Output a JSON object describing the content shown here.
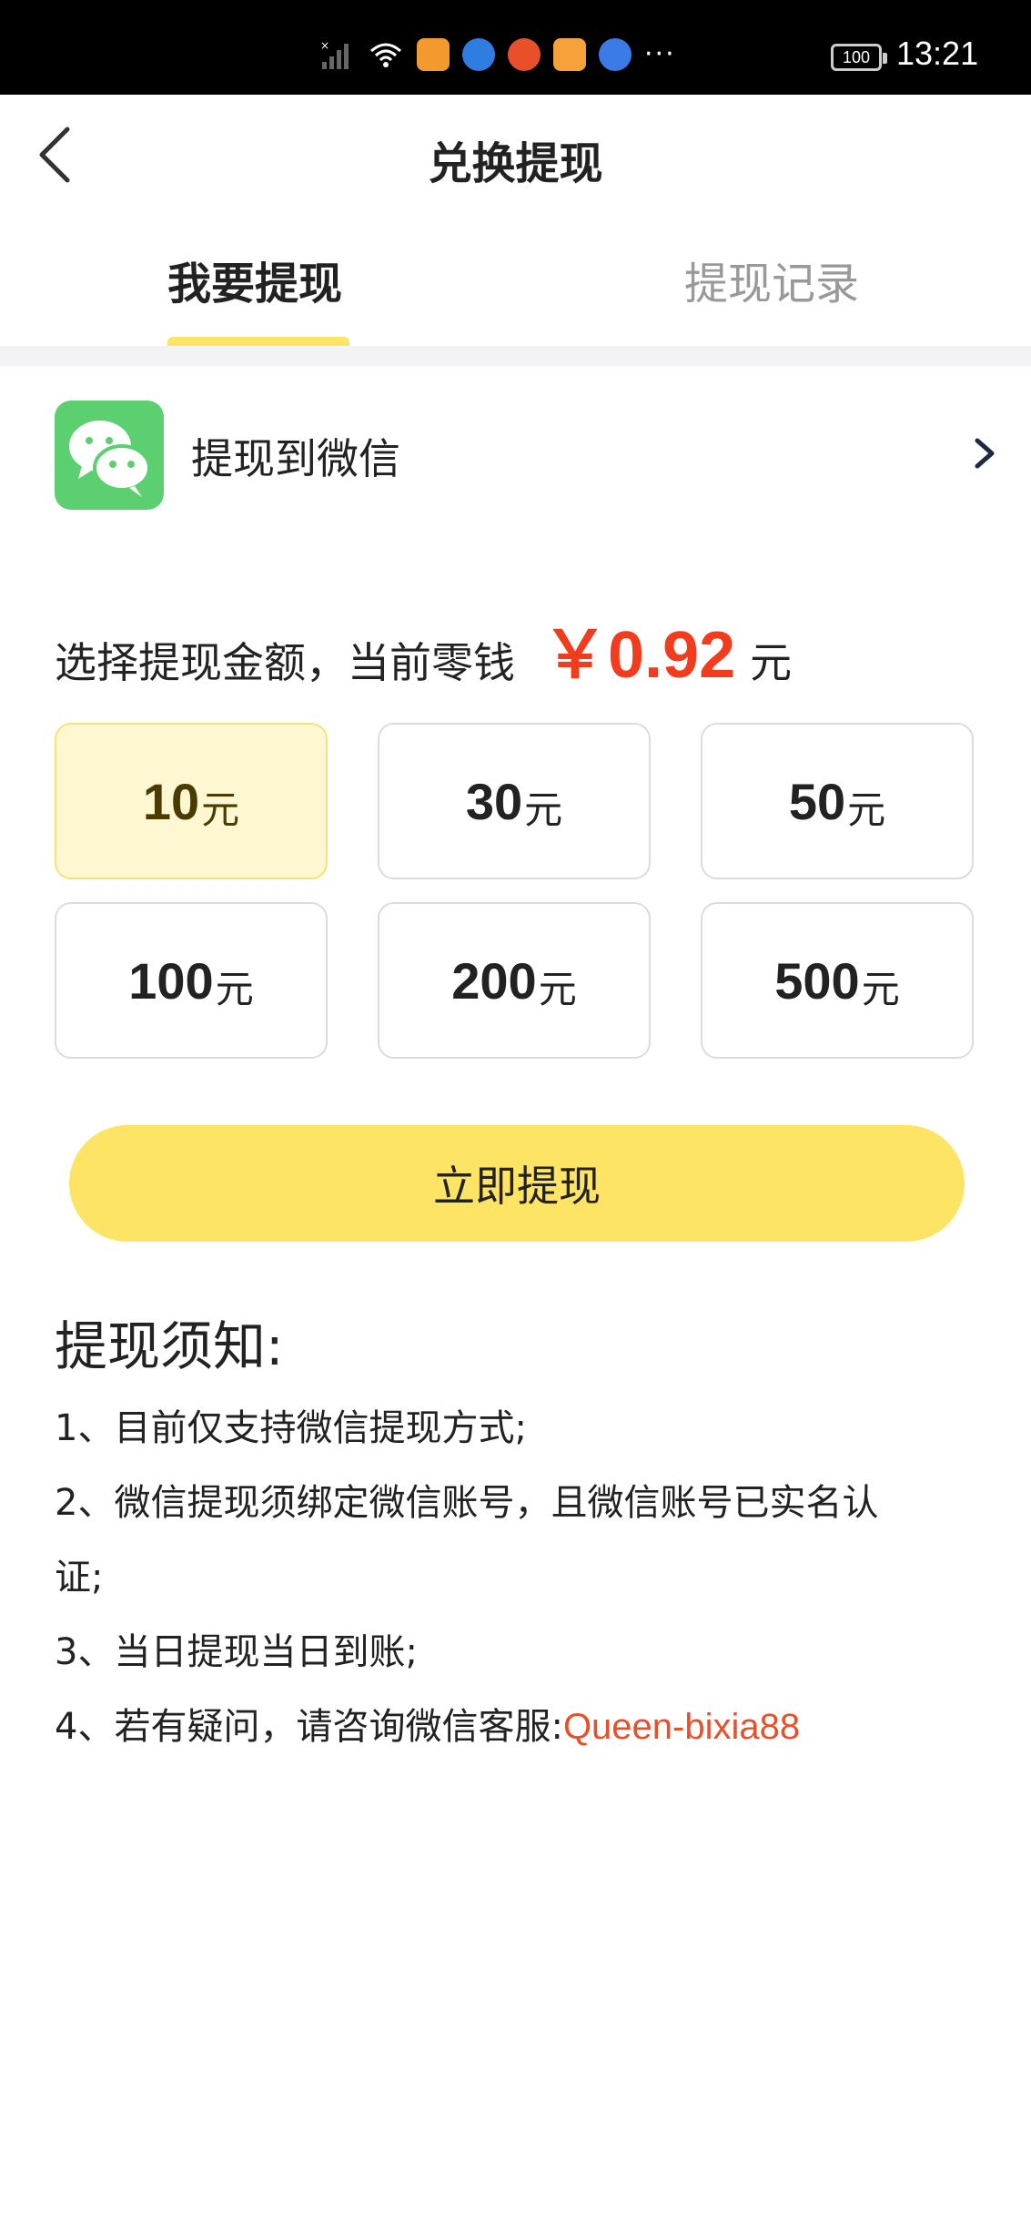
{
  "status_bar": {
    "time": "13:21",
    "battery": "100",
    "more_glyph": "···",
    "app_icon_colors": [
      "#f29a2e",
      "#2f7de1",
      "#e8502a",
      "#f6a13a",
      "#3a7be8"
    ]
  },
  "header": {
    "title": "兑换提现"
  },
  "tabs": [
    {
      "label": "我要提现",
      "active": true
    },
    {
      "label": "提现记录",
      "active": false
    }
  ],
  "wechat": {
    "label": "提现到微信"
  },
  "amount": {
    "prompt": "选择提现金额，当前零钱",
    "balance": "￥0.92",
    "unit": "元"
  },
  "options": [
    {
      "amount": "10",
      "unit": "元",
      "selected": true
    },
    {
      "amount": "30",
      "unit": "元",
      "selected": false
    },
    {
      "amount": "50",
      "unit": "元",
      "selected": false
    },
    {
      "amount": "100",
      "unit": "元",
      "selected": false
    },
    {
      "amount": "200",
      "unit": "元",
      "selected": false
    },
    {
      "amount": "500",
      "unit": "元",
      "selected": false
    }
  ],
  "withdraw_button": "立即提现",
  "notice": {
    "title": "提现须知:",
    "lines": [
      "1、目前仅支持微信提现方式;",
      "2、微信提现须绑定微信账号，且微信账号已实名认",
      "证;",
      "3、当日提现当日到账;",
      "4、若有疑问，请咨询微信客服:"
    ],
    "contact": "Queen-bixia88"
  },
  "colors": {
    "accent_yellow": "#fde464",
    "selected_bg": "#fff7d1",
    "balance_red": "#f23c1e",
    "link_red": "#e8502a",
    "wechat_green": "#5cd071"
  }
}
